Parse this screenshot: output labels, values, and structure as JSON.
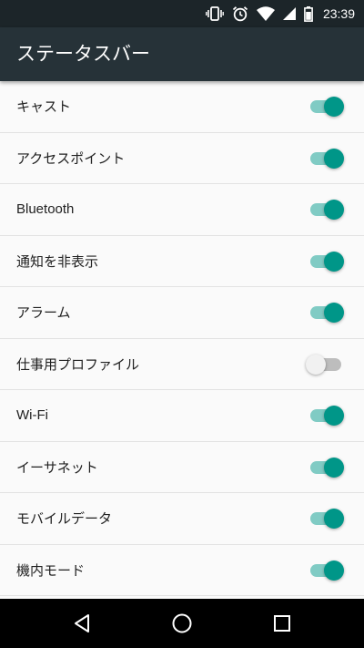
{
  "status_bar": {
    "time": "23:39",
    "icons": [
      "vibrate-icon",
      "alarm-icon",
      "wifi-icon",
      "signal-icon",
      "battery-icon"
    ]
  },
  "app_bar": {
    "title": "ステータスバー"
  },
  "settings": [
    {
      "label": "キャスト",
      "enabled": true
    },
    {
      "label": "アクセスポイント",
      "enabled": true
    },
    {
      "label": "Bluetooth",
      "enabled": true
    },
    {
      "label": "通知を非表示",
      "enabled": true
    },
    {
      "label": "アラーム",
      "enabled": true
    },
    {
      "label": "仕事用プロファイル",
      "enabled": false
    },
    {
      "label": "Wi-Fi",
      "enabled": true
    },
    {
      "label": "イーサネット",
      "enabled": true
    },
    {
      "label": "モバイルデータ",
      "enabled": true
    },
    {
      "label": "機内モード",
      "enabled": true
    }
  ],
  "nav_bar": {
    "buttons": [
      "back-icon",
      "home-icon",
      "recents-icon"
    ]
  },
  "colors": {
    "status_bar": "#1c2529",
    "app_bar": "#263238",
    "accent": "#009688",
    "accent_track": "#80cbc4",
    "background": "#fafafa"
  }
}
